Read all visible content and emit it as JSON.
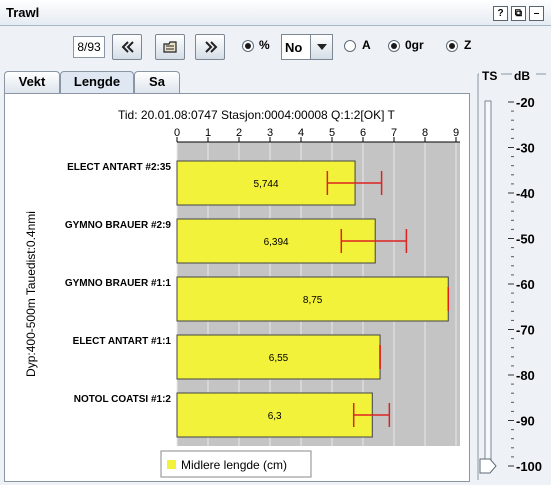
{
  "window": {
    "title": "Trawl",
    "buttons": [
      "?",
      "⧉",
      "–"
    ]
  },
  "toolbar": {
    "page_value": "8/93",
    "percent_label": "%",
    "combo_value": "No",
    "option_a_label": "A",
    "option_0gr_label": "0gr",
    "option_z_label": "Z",
    "percent_checked": true,
    "option_a_checked": false,
    "option_0gr_checked": true,
    "option_z_checked": true
  },
  "tabs": [
    {
      "label": "Vekt",
      "active": false
    },
    {
      "label": "Lengde",
      "active": true
    },
    {
      "label": "Sa",
      "active": false
    }
  ],
  "ts_panel": {
    "ts_label": "TS",
    "db_label": "dB",
    "scale": [
      "-20",
      "-30",
      "-40",
      "-50",
      "-60",
      "-70",
      "-80",
      "-90",
      "-100"
    ],
    "slider_value": -100
  },
  "chart_data": {
    "type": "bar",
    "orientation": "horizontal",
    "header": "Tid: 20.01.08:0747   Stasjon:0004:00008   Q:1:2[OK]  T",
    "ylabel": "Dyp:400-500m Tauedist:0.4nmi",
    "xlim": [
      0,
      9
    ],
    "xticks": [
      "0",
      "1",
      "2",
      "3",
      "4",
      "5",
      "6",
      "7",
      "8",
      "9"
    ],
    "grid": true,
    "bar_color": "#f2f23a",
    "error_color": "#dd2222",
    "categories": [
      "ELECT ANTART #2:35",
      "GYMNO BRAUER #2:9",
      "GYMNO BRAUER #1:1",
      "ELECT ANTART #1:1",
      "NOTOL COATSI #1:2"
    ],
    "values": [
      5.744,
      6.394,
      8.75,
      6.55,
      6.3
    ],
    "value_labels": [
      "5,744",
      "6,394",
      "8,75",
      "6,55",
      "6,3"
    ],
    "error_low": [
      4.85,
      5.3,
      8.75,
      6.55,
      5.7
    ],
    "error_high": [
      6.6,
      7.4,
      8.75,
      6.55,
      6.85
    ],
    "legend": [
      {
        "name": "Midlere lengde (cm)",
        "color": "#f2f23a"
      }
    ],
    "legend_placement": "bottom"
  }
}
